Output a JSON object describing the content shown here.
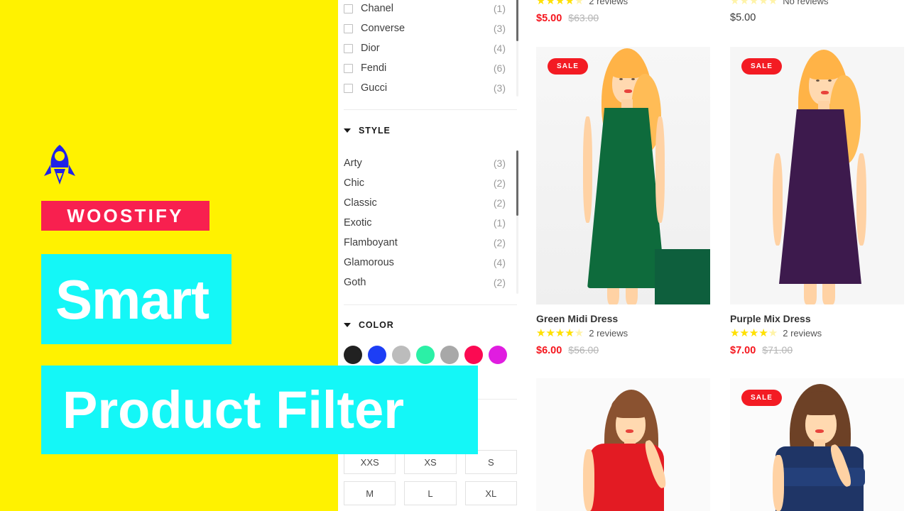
{
  "promo": {
    "background_color": "#fff200",
    "logo_icon": "woostify-rocket-icon",
    "brand_name": "WOOSTIFY",
    "brand_badge_color": "#f8204f",
    "headline_line_1": "Smart",
    "headline_line_2": "Product Filter",
    "headline_band_color": "#14f7f7",
    "headline_text_color": "#ffffff"
  },
  "sidebar": {
    "brand_filter": {
      "items": [
        {
          "label": "Chanel",
          "count": "(1)",
          "checked": false
        },
        {
          "label": "Converse",
          "count": "(3)",
          "checked": false
        },
        {
          "label": "Dior",
          "count": "(4)",
          "checked": false
        },
        {
          "label": "Fendi",
          "count": "(6)",
          "checked": false
        },
        {
          "label": "Gucci",
          "count": "(3)",
          "checked": false
        }
      ]
    },
    "style_section": {
      "title": "STYLE",
      "caret_icon": "chevron-down-icon",
      "expanded": true,
      "items": [
        {
          "label": "Arty",
          "count": "(3)"
        },
        {
          "label": "Chic",
          "count": "(2)"
        },
        {
          "label": "Classic",
          "count": "(2)"
        },
        {
          "label": "Exotic",
          "count": "(1)"
        },
        {
          "label": "Flamboyant",
          "count": "(2)"
        },
        {
          "label": "Glamorous",
          "count": "(4)"
        },
        {
          "label": "Goth",
          "count": "(2)"
        }
      ]
    },
    "color_section": {
      "title": "COLOR",
      "caret_icon": "chevron-down-icon",
      "expanded": true,
      "swatches": [
        {
          "name": "black",
          "hex": "#212121"
        },
        {
          "name": "blue",
          "hex": "#1d3ef5"
        },
        {
          "name": "grey",
          "hex": "#bcbcbc"
        },
        {
          "name": "mint",
          "hex": "#2bf0a6"
        },
        {
          "name": "silver",
          "hex": "#a8a8a8"
        },
        {
          "name": "pink",
          "hex": "#fb0a52"
        },
        {
          "name": "magenta",
          "hex": "#e01de0"
        }
      ]
    },
    "size_section": {
      "sizes": [
        "XXS",
        "XS",
        "S",
        "M",
        "L",
        "XL"
      ]
    }
  },
  "products": [
    {
      "id": "top-left-partial",
      "title": "",
      "rating": 4,
      "review_text": "2 reviews",
      "sale_price": "$5.00",
      "regular_price": "$63.00",
      "on_sale": true
    },
    {
      "id": "top-right-partial",
      "title": "",
      "rating": 0,
      "review_text": "No reviews",
      "price": "$5.00",
      "on_sale": false
    },
    {
      "id": "green-midi-dress",
      "badge": "SALE",
      "title": "Green Midi Dress",
      "rating": 4,
      "review_text": "2 reviews",
      "sale_price": "$6.00",
      "regular_price": "$56.00",
      "on_sale": true,
      "dress_color": "#0e6b3c",
      "hair_color": "#ffb347"
    },
    {
      "id": "purple-mix-dress",
      "badge": "SALE",
      "title": "Purple Mix Dress",
      "rating": 4,
      "review_text": "2 reviews",
      "sale_price": "$7.00",
      "regular_price": "$71.00",
      "on_sale": true,
      "dress_color": "#3d1a4d",
      "hair_color": "#ffb347"
    },
    {
      "id": "red-dress",
      "badge": "",
      "title": "",
      "on_sale": false,
      "dress_color": "#e31b23",
      "hair_color": "#8a5230"
    },
    {
      "id": "navy-dress",
      "badge": "SALE",
      "title": "",
      "on_sale": true,
      "dress_color": "#1f3566",
      "hair_color": "#6d4126"
    }
  ],
  "colors": {
    "sale_badge": "#f31b23",
    "sale_price": "#f5161e",
    "regular_price": "#b4b4b4",
    "star_filled": "#ffe000",
    "star_empty": "#fff3a8"
  }
}
